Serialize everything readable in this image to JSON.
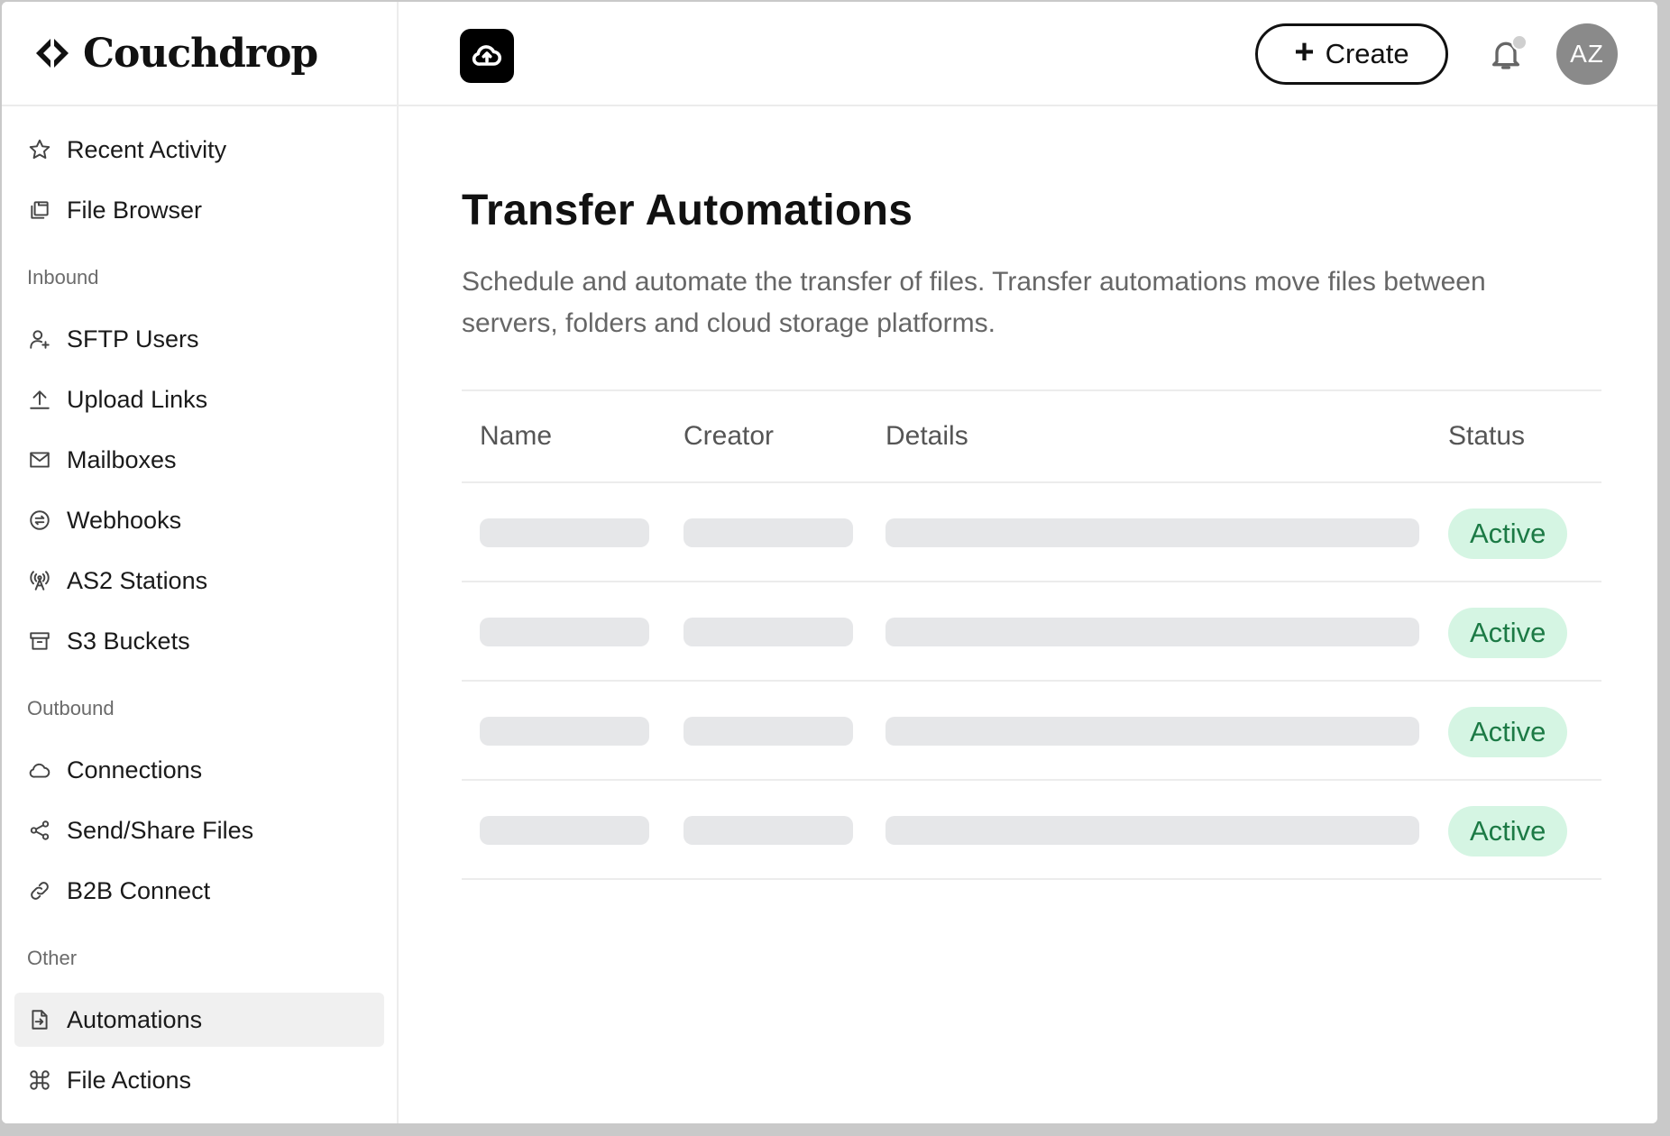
{
  "brand": {
    "name": "Couchdrop"
  },
  "sidebar": {
    "top_items": [
      {
        "label": "Recent Activity",
        "icon": "star-icon"
      },
      {
        "label": "File Browser",
        "icon": "files-icon"
      }
    ],
    "sections": [
      {
        "title": "Inbound",
        "items": [
          {
            "label": "SFTP Users",
            "icon": "user-plus-icon"
          },
          {
            "label": "Upload Links",
            "icon": "upload-icon"
          },
          {
            "label": "Mailboxes",
            "icon": "mail-icon"
          },
          {
            "label": "Webhooks",
            "icon": "webhook-icon"
          },
          {
            "label": "AS2 Stations",
            "icon": "antenna-icon"
          },
          {
            "label": "S3 Buckets",
            "icon": "archive-icon"
          }
        ]
      },
      {
        "title": "Outbound",
        "items": [
          {
            "label": "Connections",
            "icon": "cloud-icon"
          },
          {
            "label": "Send/Share Files",
            "icon": "share-icon"
          },
          {
            "label": "B2B Connect",
            "icon": "link-icon"
          }
        ]
      },
      {
        "title": "Other",
        "items": [
          {
            "label": "Automations",
            "icon": "file-arrow-icon",
            "active": true
          },
          {
            "label": "File Actions",
            "icon": "command-icon"
          }
        ]
      }
    ]
  },
  "header": {
    "app_icon": "cloud-upload-icon",
    "create_label": "Create",
    "notification_icon": "bell-icon",
    "avatar_initials": "AZ"
  },
  "main": {
    "title": "Transfer Automations",
    "description": "Schedule and automate the transfer of files. Transfer automations move files between servers, folders and cloud storage platforms.",
    "table": {
      "columns": [
        "Name",
        "Creator",
        "Details",
        "Status"
      ],
      "rows": [
        {
          "status": "Active"
        },
        {
          "status": "Active"
        },
        {
          "status": "Active"
        },
        {
          "status": "Active"
        }
      ]
    }
  },
  "colors": {
    "status_bg": "#d5f5e3",
    "status_text": "#1c7a45",
    "skeleton": "#e6e7e9",
    "active_nav_bg": "#f0f0f0"
  }
}
